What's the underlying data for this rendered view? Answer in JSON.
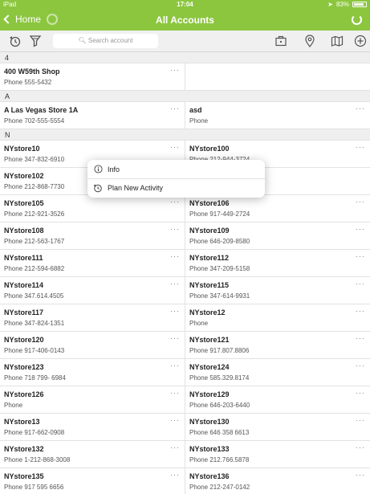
{
  "statusbar": {
    "carrier": "iPad",
    "time": "17:04",
    "battery": "83%"
  },
  "navbar": {
    "back_label": "Home",
    "title": "All Accounts"
  },
  "toolbar": {
    "search_placeholder": "Search account"
  },
  "sections": [
    {
      "letter": "4",
      "rows": [
        [
          {
            "name": "400 W59th Shop",
            "phone": "Phone 555-5432"
          },
          null
        ]
      ]
    },
    {
      "letter": "A",
      "rows": [
        [
          {
            "name": "A Las Vegas Store 1A",
            "phone": "Phone 702-555-5554"
          },
          {
            "name": "asd",
            "phone": "Phone"
          }
        ]
      ]
    },
    {
      "letter": "N",
      "rows": [
        [
          {
            "name": "NYstore10",
            "phone": "Phone 347-832-6910"
          },
          {
            "name": "NYstore100",
            "phone": "Phone 212-944-3724"
          }
        ],
        [
          {
            "name": "NYstore102",
            "phone": "Phone 212-868-7730"
          },
          {
            "name": "",
            "phone": ""
          }
        ],
        [
          {
            "name": "NYstore105",
            "phone": "Phone 212-921-3526"
          },
          {
            "name": "NYstore106",
            "phone": "Phone 917-449-2724"
          }
        ],
        [
          {
            "name": "NYstore108",
            "phone": "Phone 212-563-1767"
          },
          {
            "name": "NYstore109",
            "phone": "Phone 646-209-8580"
          }
        ],
        [
          {
            "name": "NYstore111",
            "phone": "Phone 212-594-6882"
          },
          {
            "name": "NYstore112",
            "phone": "Phone 347-209-5158"
          }
        ],
        [
          {
            "name": "NYstore114",
            "phone": "Phone 347.614.4505"
          },
          {
            "name": "NYstore115",
            "phone": "Phone 347-614-9931"
          }
        ],
        [
          {
            "name": "NYstore117",
            "phone": "Phone 347-824-1351"
          },
          {
            "name": "NYstore12",
            "phone": "Phone"
          }
        ],
        [
          {
            "name": "NYstore120",
            "phone": "Phone 917-406-0143"
          },
          {
            "name": "NYstore121",
            "phone": "Phone 917.807.8806"
          }
        ],
        [
          {
            "name": "NYstore123",
            "phone": "Phone 718 799- 6984"
          },
          {
            "name": "NYstore124",
            "phone": "Phone 585.329.8174"
          }
        ],
        [
          {
            "name": "NYstore126",
            "phone": "Phone"
          },
          {
            "name": "NYstore129",
            "phone": "Phone 646-203-6440"
          }
        ],
        [
          {
            "name": "NYstore13",
            "phone": "Phone 917-662-0908"
          },
          {
            "name": "NYstore130",
            "phone": "Phone 646 358 6613"
          }
        ],
        [
          {
            "name": "NYstore132",
            "phone": "Phone 1-212-868-3008"
          },
          {
            "name": "NYstore133",
            "phone": "Phone 212.766.5878"
          }
        ],
        [
          {
            "name": "NYstore135",
            "phone": "Phone 917 595 6656"
          },
          {
            "name": "NYstore136",
            "phone": "Phone 212-247-0142"
          }
        ]
      ]
    }
  ],
  "more_label": "···",
  "popover": {
    "items": [
      {
        "label": "Info",
        "icon": "info-icon"
      },
      {
        "label": "Plan New Activity",
        "icon": "plan-activity-icon"
      }
    ]
  },
  "colors": {
    "accent": "#8cc63f",
    "section_bg": "#efefef",
    "toolbar_bg": "#f0f0f0"
  }
}
